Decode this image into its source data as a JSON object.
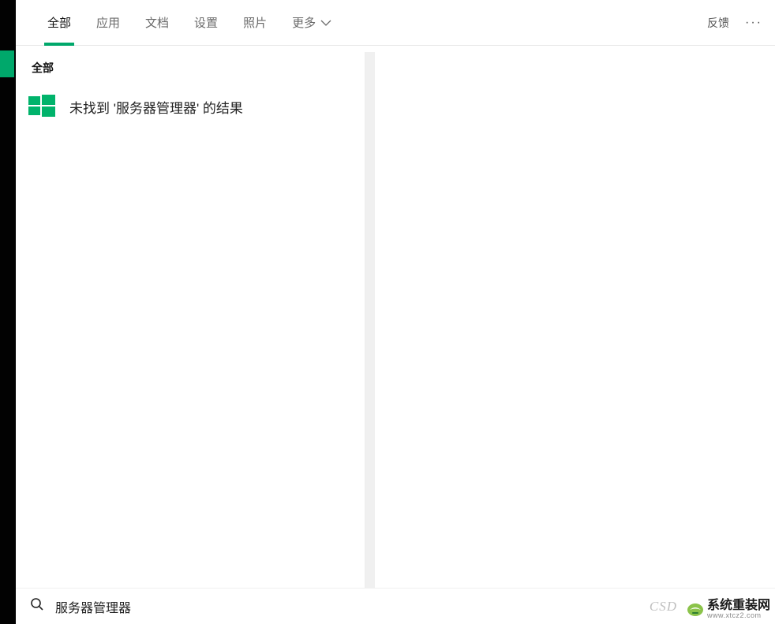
{
  "tabs": {
    "all": "全部",
    "apps": "应用",
    "docs": "文档",
    "settings": "设置",
    "photos": "照片",
    "more": "更多"
  },
  "top_right": {
    "feedback": "反馈"
  },
  "left_panel": {
    "section_header": "全部",
    "no_result_text": "未找到 '服务器管理器' 的结果"
  },
  "search": {
    "value": "服务器管理器"
  },
  "watermark": "CSD",
  "brand": {
    "main": "系统重装网",
    "sub": "www.xtcz2.com"
  },
  "colors": {
    "accent": "#00a86b"
  }
}
